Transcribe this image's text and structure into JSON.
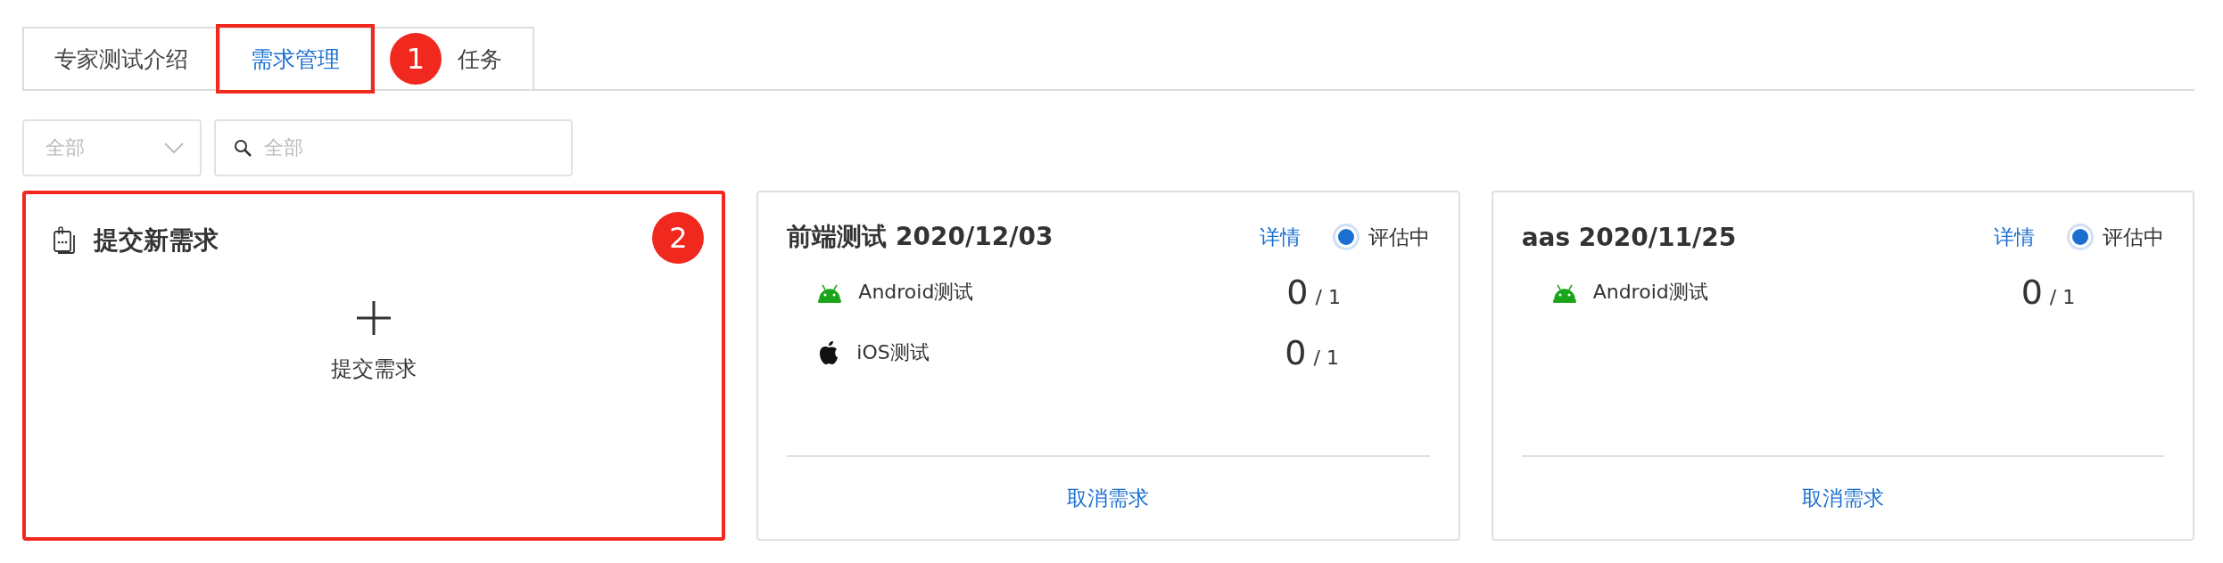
{
  "tabs": [
    {
      "label": "专家测试介绍",
      "selected": false,
      "highlighted": false
    },
    {
      "label": "需求管理",
      "selected": true,
      "highlighted": true,
      "badge": "1"
    },
    {
      "label": "任务",
      "selected": false,
      "highlighted": false
    }
  ],
  "filters": {
    "select": {
      "placeholder": "全部"
    },
    "search": {
      "placeholder": "全部"
    }
  },
  "new_card": {
    "title": "提交新需求",
    "action": "提交需求",
    "highlighted": true,
    "badge": "2"
  },
  "cards": [
    {
      "title": "前端测试 2020/12/03",
      "details_link": "详情",
      "status": {
        "label": "评估中",
        "selected": true
      },
      "items": [
        {
          "kind": "android",
          "name": "Android测试",
          "done": "0",
          "total": "/ 1"
        },
        {
          "kind": "ios",
          "name": "iOS测试",
          "done": "0",
          "total": "/ 1"
        }
      ],
      "cancel": "取消需求"
    },
    {
      "title": "aas 2020/11/25",
      "details_link": "详情",
      "status": {
        "label": "评估中",
        "selected": true
      },
      "items": [
        {
          "kind": "android",
          "name": "Android测试",
          "done": "0",
          "total": "/ 1"
        }
      ],
      "cancel": "取消需求"
    }
  ]
}
